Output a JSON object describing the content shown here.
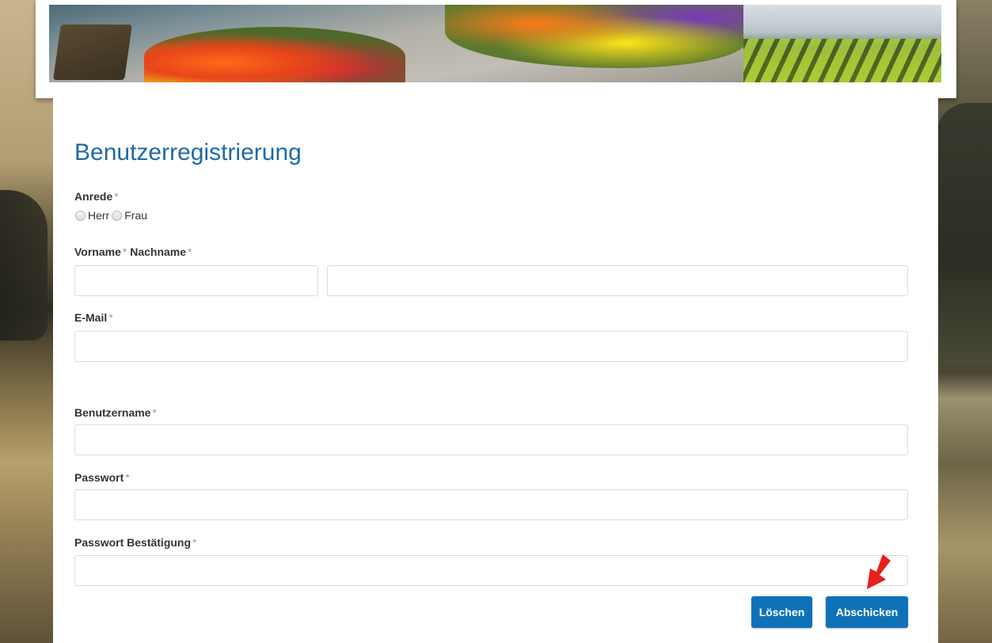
{
  "form": {
    "title": "Benutzerregistrierung",
    "required_mark": "*",
    "salutation": {
      "label": "Anrede",
      "options": [
        "Herr",
        "Frau"
      ]
    },
    "first_name_label": "Vorname",
    "last_name_label": "Nachname",
    "email_label": "E-Mail",
    "username_label": "Benutzername",
    "password_label": "Passwort",
    "password_confirm_label": "Passwort Bestätigung",
    "buttons": {
      "reset": "Löschen",
      "submit": "Abschicken"
    }
  },
  "colors": {
    "title": "#1f6aa6",
    "button": "#0f72b8",
    "arrow": "#e8201a"
  }
}
